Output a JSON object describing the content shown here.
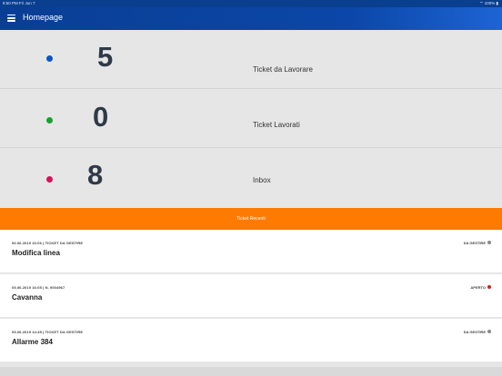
{
  "status_bar": {
    "time_day": "8:50 PM   Fri Jun 7",
    "right": "⌔ 100% ▮"
  },
  "header": {
    "title": "Homepage"
  },
  "stats": [
    {
      "value": "5",
      "label": "Ticket da Lavorare",
      "color": "#0b57c2"
    },
    {
      "value": "0",
      "label": "Ticket Lavorati",
      "color": "#14a32e"
    },
    {
      "value": "8",
      "label": "Inbox",
      "color": "#d4145a"
    }
  ],
  "recent": {
    "label": "Ticket Recenti",
    "color": "#ff7a00"
  },
  "tickets": [
    {
      "meta": "06.06.2019 16:06 | TICKET DA GESTIRE",
      "name": "Modifica linea",
      "status": "DA GESTIRE",
      "status_color": "#8a8a8a"
    },
    {
      "meta": "05.06.2019 16:05 | N. 9004967",
      "name": "Cavanna",
      "status": "APERTO",
      "status_color": "#e01b1b"
    },
    {
      "meta": "05.06.2019 14:45 | TICKET DA GESTIRE",
      "name": "Allarme 384",
      "status": "DA GESTIRE",
      "status_color": "#8a8a8a"
    }
  ]
}
